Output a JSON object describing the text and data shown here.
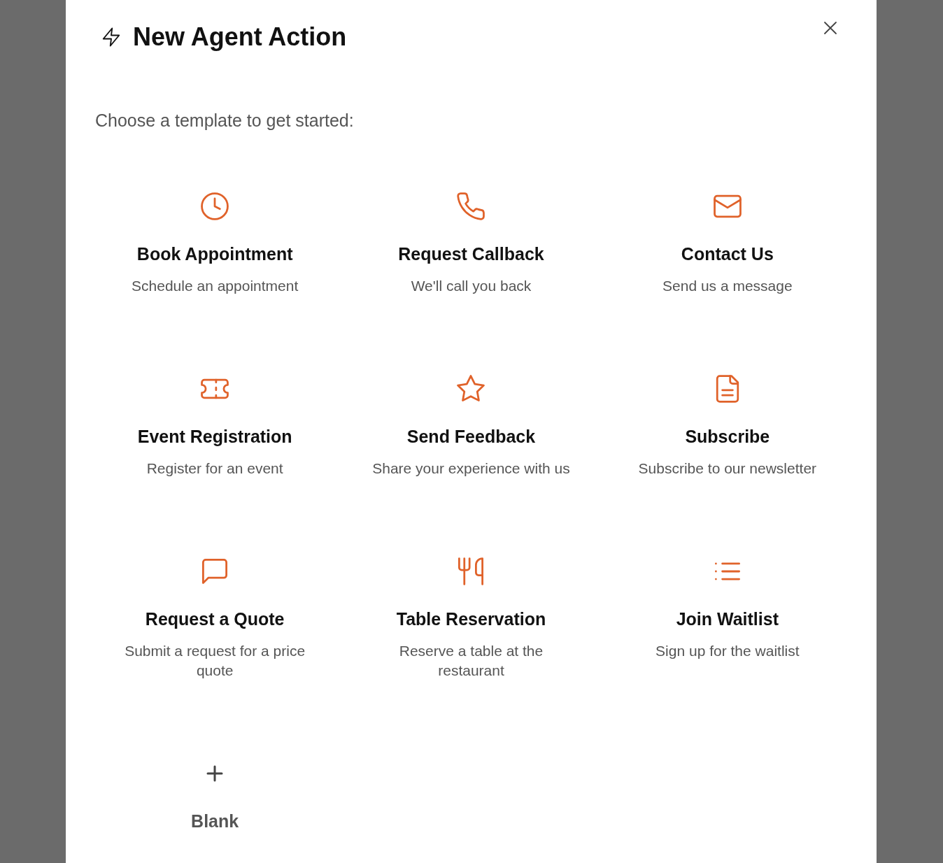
{
  "dialog": {
    "title": "New Agent Action",
    "prompt": "Choose a template to get started:"
  },
  "templates": [
    {
      "kind": "template",
      "title": "Book Appointment",
      "description": "Schedule an appointment"
    },
    {
      "kind": "template",
      "title": "Request Callback",
      "description": "We'll call you back"
    },
    {
      "kind": "template",
      "title": "Contact Us",
      "description": "Send us a message"
    },
    {
      "kind": "template",
      "title": "Event Registration",
      "description": "Register for an event"
    },
    {
      "kind": "template",
      "title": "Send Feedback",
      "description": "Share your experience with us"
    },
    {
      "kind": "template",
      "title": "Subscribe",
      "description": "Subscribe to our newsletter"
    },
    {
      "kind": "template",
      "title": "Request a Quote",
      "description": "Submit a request for a price quote"
    },
    {
      "kind": "template",
      "title": "Table Reservation",
      "description": "Reserve a table at the restaurant"
    },
    {
      "kind": "template",
      "title": "Join Waitlist",
      "description": "Sign up for the waitlist"
    },
    {
      "kind": "blank",
      "title": "Blank"
    }
  ]
}
